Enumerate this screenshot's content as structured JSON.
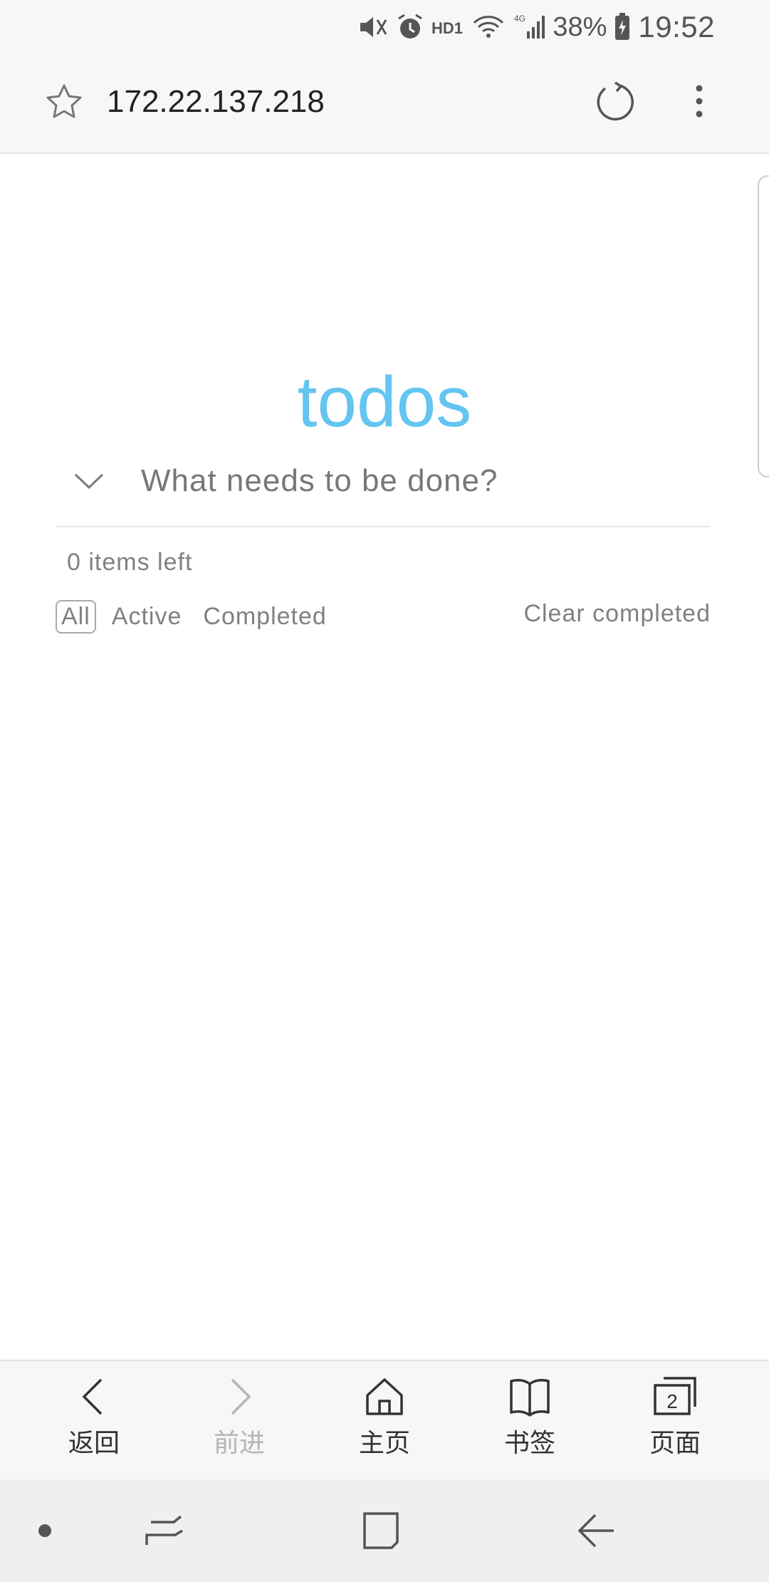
{
  "status_bar": {
    "icons": [
      "mute-vibrate-icon",
      "alarm-icon",
      "hd-voice-icon",
      "wifi-icon",
      "signal-4g-icon",
      "battery-charging-icon"
    ],
    "hd_label": "HD1",
    "network_label": "4G",
    "battery": "38%",
    "time": "19:52"
  },
  "browser": {
    "url": "172.22.137.218"
  },
  "app": {
    "title": "todos",
    "new_todo_placeholder": "What needs to be done?",
    "items_left": "0 items left",
    "filters": [
      "All",
      "Active",
      "Completed"
    ],
    "selected_filter": "All",
    "clear_completed": "Clear completed",
    "accent_color": "#63c5f0"
  },
  "toolbar": {
    "items": [
      {
        "label": "返回",
        "icon": "back-icon",
        "enabled": true
      },
      {
        "label": "前进",
        "icon": "forward-icon",
        "enabled": false
      },
      {
        "label": "主页",
        "icon": "home-icon",
        "enabled": true
      },
      {
        "label": "书签",
        "icon": "bookmarks-icon",
        "enabled": true
      },
      {
        "label": "页面",
        "icon": "tabs-icon",
        "enabled": true,
        "badge": "2"
      }
    ]
  },
  "nav_bar": {
    "buttons": [
      "dot-icon",
      "recents-icon",
      "home-button-icon",
      "back-arrow-icon"
    ]
  }
}
